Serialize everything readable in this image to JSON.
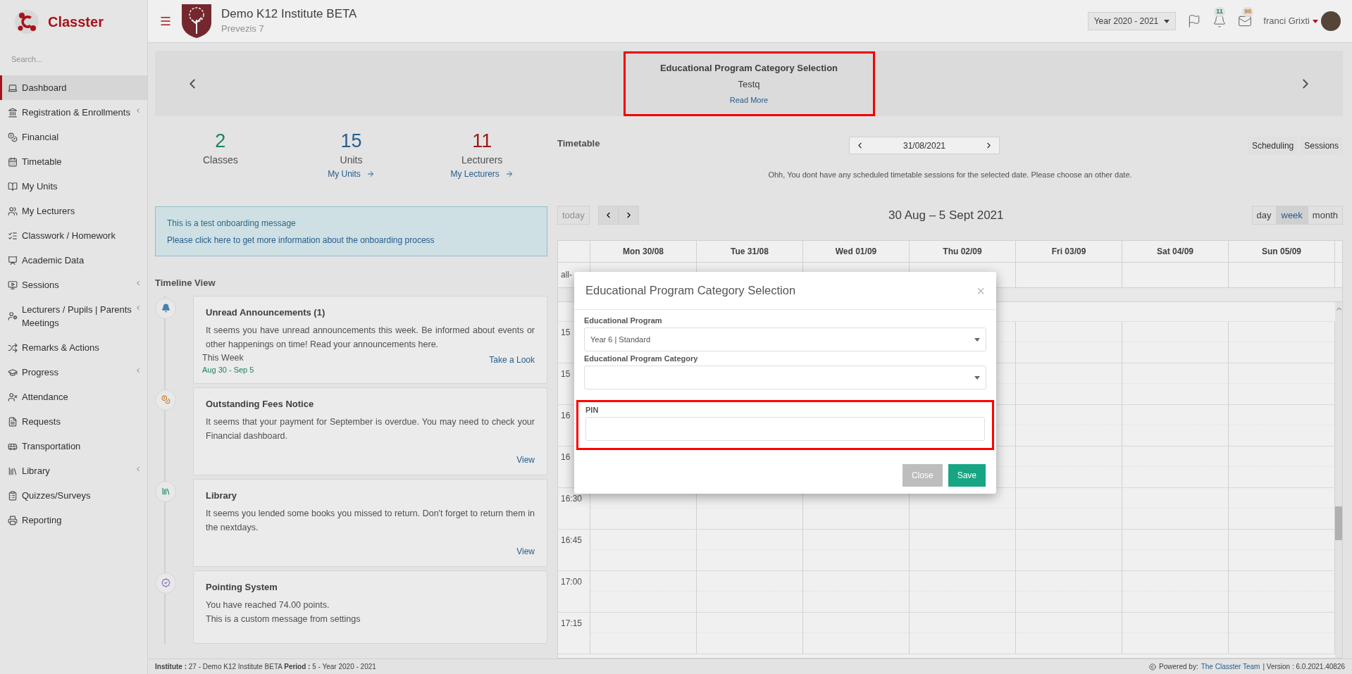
{
  "sidebar": {
    "logo": "Classter",
    "search": {
      "placeholder": "Search..."
    },
    "items": [
      {
        "label": "Dashboard",
        "selected": true,
        "expandable": false
      },
      {
        "label": "Registration & Enrollments",
        "selected": false,
        "expandable": true
      },
      {
        "label": "Financial",
        "selected": false,
        "expandable": false
      },
      {
        "label": "Timetable",
        "selected": false,
        "expandable": false
      },
      {
        "label": "My Units",
        "selected": false,
        "expandable": false
      },
      {
        "label": "My Lecturers",
        "selected": false,
        "expandable": false
      },
      {
        "label": "Classwork / Homework",
        "selected": false,
        "expandable": false
      },
      {
        "label": "Academic Data",
        "selected": false,
        "expandable": false
      },
      {
        "label": "Sessions",
        "selected": false,
        "expandable": true
      },
      {
        "label": "Lecturers / Pupils | Parents Meetings",
        "selected": false,
        "expandable": true
      },
      {
        "label": "Remarks & Actions",
        "selected": false,
        "expandable": false
      },
      {
        "label": "Progress",
        "selected": false,
        "expandable": true
      },
      {
        "label": "Attendance",
        "selected": false,
        "expandable": false
      },
      {
        "label": "Requests",
        "selected": false,
        "expandable": false
      },
      {
        "label": "Transportation",
        "selected": false,
        "expandable": false
      },
      {
        "label": "Library",
        "selected": false,
        "expandable": true
      },
      {
        "label": "Quizzes/Surveys",
        "selected": false,
        "expandable": false
      },
      {
        "label": "Reporting",
        "selected": false,
        "expandable": false
      }
    ]
  },
  "header": {
    "institute": "Demo K12 Institute BETA",
    "address": "Prevezis 7",
    "year": "Year 2020 - 2021",
    "notifications": "11",
    "messages": "96",
    "user": "franci Grixti"
  },
  "banner": {
    "title": "Educational Program Category Selection",
    "text": "Testq",
    "link": "Read More",
    "highlighted": true
  },
  "stats": [
    {
      "value": "2",
      "label": "Classes",
      "color": "#1e8a6e"
    },
    {
      "value": "15",
      "label": "Units",
      "link": "My Units",
      "color": "#2a6496"
    },
    {
      "value": "11",
      "label": "Lecturers",
      "link": "My Lecturers",
      "color": "#a21c1c"
    }
  ],
  "onboarding": {
    "message": "This is a test onboarding message",
    "link": "Please click here to get more information about the onboarding process"
  },
  "timeline": {
    "title": "Timeline View",
    "items": [
      {
        "kind": "announcement",
        "title": "Unread Announcements (1)",
        "text": "It seems you have unread announcements this week. Be informed about events or other happenings on time! Read your announcements here.",
        "period": "This Week",
        "dates": "Aug 30 - Sep 5",
        "action": "Take a Look"
      },
      {
        "kind": "fees",
        "title": "Outstanding Fees Notice",
        "text": "It seems that your payment for September is overdue. You may need to check your Financial dashboard.",
        "action": "View"
      },
      {
        "kind": "library",
        "title": "Library",
        "text": "It seems you lended some books you missed to return. Don't forget to return them in the nextdays.",
        "action": "View"
      },
      {
        "kind": "points",
        "title": "Pointing System",
        "text": "You have reached 74.00 points.",
        "note": "This is a custom message from settings"
      }
    ]
  },
  "timetable": {
    "title": "Timetable",
    "date": "31/08/2021",
    "buttons": [
      "Scheduling",
      "Sessions"
    ],
    "message": "Ohh, You dont have any scheduled timetable sessions for the selected date. Please choose an other date.",
    "today": "today",
    "range": "30 Aug – 5 Sept 2021",
    "views": [
      {
        "label": "day",
        "selected": false
      },
      {
        "label": "week",
        "selected": true
      },
      {
        "label": "month",
        "selected": false
      }
    ],
    "days": [
      "Mon 30/08",
      "Tue 31/08",
      "Wed 01/09",
      "Thu 02/09",
      "Fri 03/09",
      "Sat 04/09",
      "Sun 05/09"
    ],
    "allday": "all-",
    "times": [
      "15",
      "15",
      "16",
      "16",
      "16:30",
      "16:45",
      "17:00",
      "17:15"
    ]
  },
  "modal": {
    "title": "Educational Program Category Selection",
    "close": "×",
    "fields": [
      {
        "label": "Educational Program",
        "kind": "select",
        "value": "Year 6 | Standard",
        "highlighted": false
      },
      {
        "label": "Educational Program Category",
        "kind": "select",
        "highlighted": false
      },
      {
        "label": "PIN",
        "kind": "text",
        "highlighted": true
      }
    ],
    "buttons": [
      {
        "label": "Close",
        "kind": "secondary"
      },
      {
        "label": "Save",
        "kind": "primary"
      }
    ]
  },
  "status_bar": {
    "info": "**Institute :** 27 - Demo K12 Institute BETA **Period :** 5 - Year 2020 - 2021",
    "powered": "Powered by:",
    "team": "The Classter Team",
    "version": "| Version : 6.0.2021.40826"
  }
}
